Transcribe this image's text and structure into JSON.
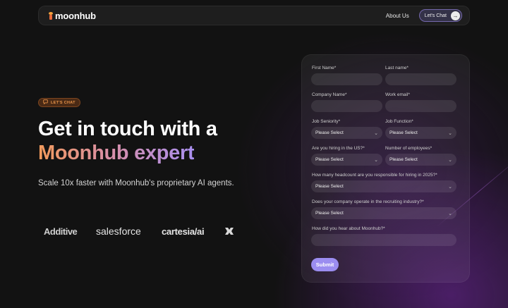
{
  "nav": {
    "logo_text": "moonhub",
    "about_label": "About Us",
    "chat_label": "Let's Chat",
    "chat_arrow": "→"
  },
  "hero": {
    "badge_label": "LET'S CHAT",
    "title_line1": "Get in touch with a",
    "title_line2": "Moonhub expert",
    "subtitle": "Scale 10x faster with Moonhub's proprietary AI agents."
  },
  "logos": [
    "Additive",
    "salesforce",
    "cartesia/ai"
  ],
  "form": {
    "first_name_label": "First Name*",
    "last_name_label": "Last name*",
    "company_name_label": "Company Name*",
    "work_email_label": "Work email*",
    "job_seniority_label": "Job Seniority*",
    "job_seniority_value": "Please Select",
    "job_function_label": "Job Function*",
    "job_function_value": "Please Select",
    "hiring_us_label": "Are you hiring in the US?*",
    "hiring_us_value": "Please Select",
    "employees_label": "Number of employees*",
    "employees_value": "Please Select",
    "headcount_label": "How many headcount are you responsible for hiring in 2025?*",
    "headcount_value": "Please Select",
    "recruiting_label": "Does your company operate in the recruiting industry?*",
    "recruiting_value": "Please Select",
    "hear_label": "How did you hear about Moonhub?*",
    "submit_label": "Submit"
  },
  "colors": {
    "accent": "#9b8df0",
    "badge": "#e9954a",
    "gradient_start": "#f29a5c",
    "gradient_end": "#a98ff0",
    "background": "#121212"
  },
  "icons": {
    "select": "chevron-down-icon",
    "badge": "chat-bubble-icon",
    "chat_button": "arrow-right-icon"
  }
}
